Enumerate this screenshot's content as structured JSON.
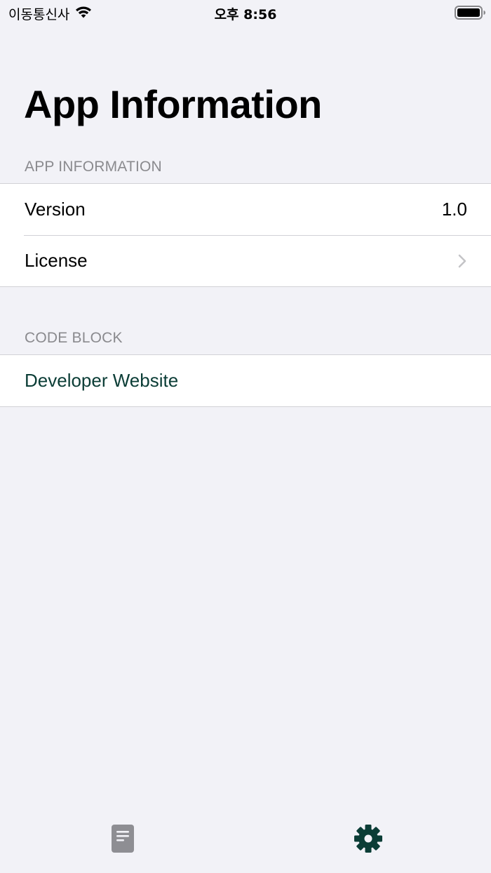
{
  "status_bar": {
    "carrier": "이동통신사",
    "time": "오후 8:56"
  },
  "title": "App Information",
  "sections": [
    {
      "header": "APP INFORMATION",
      "rows": [
        {
          "label": "Version",
          "value": "1.0"
        },
        {
          "label": "License"
        }
      ]
    },
    {
      "header": "CODE BLOCK",
      "rows": [
        {
          "label": "Developer Website"
        }
      ]
    }
  ],
  "tab_bar": {
    "tabs": [
      {
        "icon": "document-icon",
        "active": false
      },
      {
        "icon": "gear-icon",
        "active": true
      }
    ]
  },
  "colors": {
    "background": "#f2f2f7",
    "accent": "#0b3d36",
    "inactive_tab": "#8e8e93",
    "secondary_text": "#8a8a8e"
  }
}
